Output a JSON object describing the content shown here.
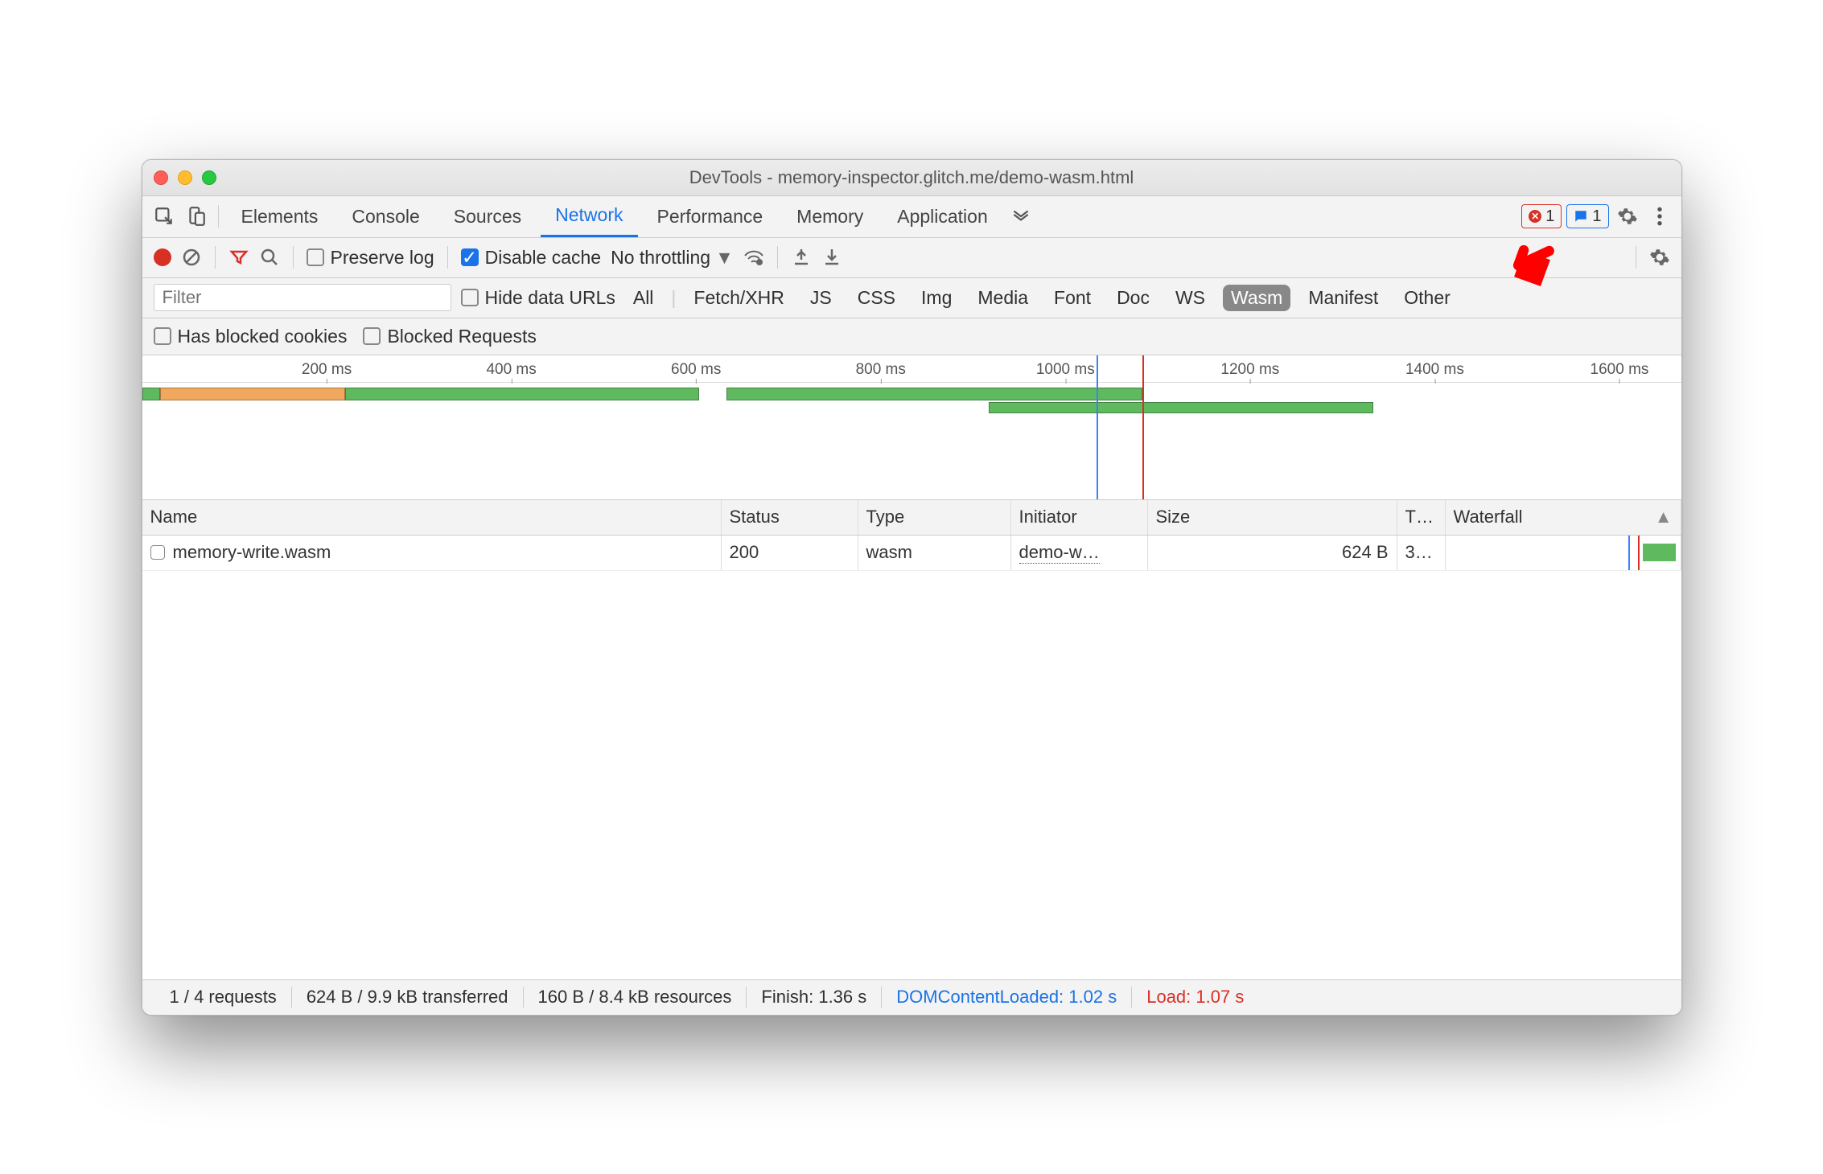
{
  "window_title": "DevTools - memory-inspector.glitch.me/demo-wasm.html",
  "tabs": {
    "elements": "Elements",
    "console": "Console",
    "sources": "Sources",
    "network": "Network",
    "performance": "Performance",
    "memory": "Memory",
    "application": "Application"
  },
  "badges": {
    "errors": "1",
    "messages": "1"
  },
  "toolbar": {
    "preserve_log": "Preserve log",
    "disable_cache": "Disable cache",
    "throttling": "No throttling"
  },
  "filter": {
    "placeholder": "Filter",
    "hide_data_urls": "Hide data URLs",
    "types": {
      "all": "All",
      "fetch": "Fetch/XHR",
      "js": "JS",
      "css": "CSS",
      "img": "Img",
      "media": "Media",
      "font": "Font",
      "doc": "Doc",
      "ws": "WS",
      "wasm": "Wasm",
      "manifest": "Manifest",
      "other": "Other"
    },
    "has_blocked_cookies": "Has blocked cookies",
    "blocked_requests": "Blocked Requests"
  },
  "overview_ticks": [
    "200 ms",
    "400 ms",
    "600 ms",
    "800 ms",
    "1000 ms",
    "1200 ms",
    "1400 ms",
    "1600 ms"
  ],
  "columns": {
    "name": "Name",
    "status": "Status",
    "type": "Type",
    "initiator": "Initiator",
    "size": "Size",
    "time": "T…",
    "waterfall": "Waterfall"
  },
  "rows": [
    {
      "name": "memory-write.wasm",
      "status": "200",
      "type": "wasm",
      "initiator": "demo-w…",
      "size": "624 B",
      "time": "3…"
    }
  ],
  "status": {
    "requests": "1 / 4 requests",
    "transferred": "624 B / 9.9 kB transferred",
    "resources": "160 B / 8.4 kB resources",
    "finish": "Finish: 1.36 s",
    "dcl": "DOMContentLoaded: 1.02 s",
    "load": "Load: 1.07 s"
  }
}
